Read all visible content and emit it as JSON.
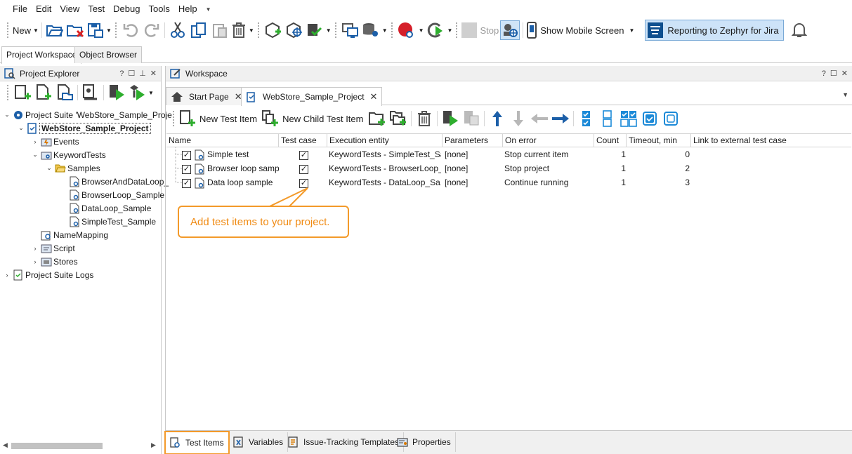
{
  "menu": {
    "items": [
      {
        "label": "File"
      },
      {
        "label": "Edit"
      },
      {
        "label": "View"
      },
      {
        "label": "Test"
      },
      {
        "label": "Debug"
      },
      {
        "label": "Tools"
      },
      {
        "label": "Help"
      }
    ]
  },
  "toolbar": {
    "new_label": "New",
    "stop_label": "Stop",
    "show_mobile_label": "Show Mobile Screen",
    "zephyr_label": "Reporting to Zephyr for Jira"
  },
  "left_tabs": {
    "workspace": "Project Workspace",
    "object_browser": "Object Browser"
  },
  "project_explorer": {
    "title": "Project Explorer",
    "tree": [
      {
        "label": "Project Suite 'WebStore_Sample_Proje"
      },
      {
        "label": "WebStore_Sample_Project"
      },
      {
        "label": "Events"
      },
      {
        "label": "KeywordTests"
      },
      {
        "label": "Samples"
      },
      {
        "label": "BrowserAndDataLoop_"
      },
      {
        "label": "BrowserLoop_Sample"
      },
      {
        "label": "DataLoop_Sample"
      },
      {
        "label": "SimpleTest_Sample"
      },
      {
        "label": "NameMapping"
      },
      {
        "label": "Script"
      },
      {
        "label": "Stores"
      },
      {
        "label": "Project Suite Logs"
      }
    ]
  },
  "workspace": {
    "title": "Workspace",
    "tabs": [
      {
        "label": "Start Page"
      },
      {
        "label": "WebStore_Sample_Project"
      }
    ],
    "toolbar": {
      "new_test_item": "New Test Item",
      "new_child_test_item": "New Child Test Item"
    },
    "columns": [
      "Name",
      "Test case",
      "Execution entity",
      "Parameters",
      "On error",
      "Count",
      "Timeout, min",
      "Link to external test case"
    ],
    "rows": [
      {
        "name": "Simple test",
        "entity": "KeywordTests - SimpleTest_Sa...",
        "params": "[none]",
        "on_error": "Stop current item",
        "count": "1",
        "timeout": "0"
      },
      {
        "name": "Browser loop sample",
        "entity": "KeywordTests - BrowserLoop_...",
        "params": "[none]",
        "on_error": "Stop project",
        "count": "1",
        "timeout": "2"
      },
      {
        "name": "Data loop sample",
        "entity": "KeywordTests - DataLoop_Sa...",
        "params": "[none]",
        "on_error": "Continue running",
        "count": "1",
        "timeout": "3"
      }
    ],
    "callout": "Add test items to your project.",
    "bottom_tabs": [
      {
        "label": "Test Items"
      },
      {
        "label": "Variables"
      },
      {
        "label": "Issue-Tracking Templates"
      },
      {
        "label": "Properties"
      }
    ]
  },
  "colors": {
    "accent_orange": "#f39a2a",
    "selection_blue": "#cde3f8",
    "green": "#2eae2e"
  }
}
